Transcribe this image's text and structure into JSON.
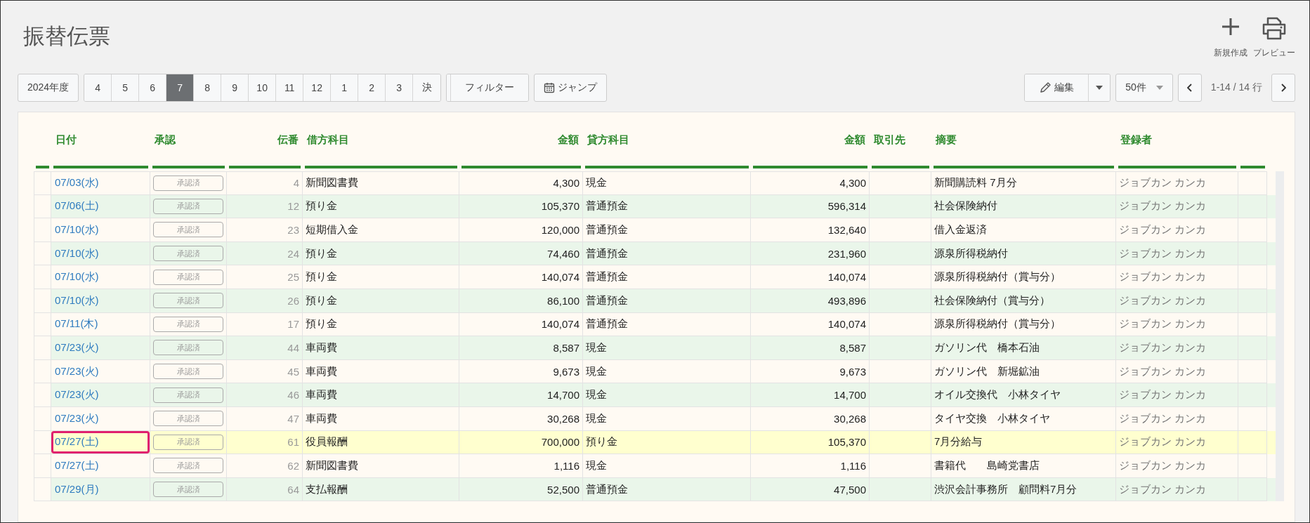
{
  "page": {
    "title": "振替伝票"
  },
  "actions": [
    {
      "kind": "new",
      "label": "新規作成"
    },
    {
      "kind": "preview",
      "label": "プレビュー"
    }
  ],
  "toolbar": {
    "fiscal_year": "2024年度",
    "months": [
      {
        "label": "4",
        "selected": false
      },
      {
        "label": "5",
        "selected": false
      },
      {
        "label": "6",
        "selected": false
      },
      {
        "label": "7",
        "selected": true
      },
      {
        "label": "8",
        "selected": false
      },
      {
        "label": "9",
        "selected": false
      },
      {
        "label": "10",
        "selected": false
      },
      {
        "label": "11",
        "selected": false
      },
      {
        "label": "12",
        "selected": false
      },
      {
        "label": "1",
        "selected": false
      },
      {
        "label": "2",
        "selected": false
      },
      {
        "label": "3",
        "selected": false
      },
      {
        "label": "決",
        "selected": false
      }
    ],
    "filter": "フィルター",
    "jump": "ジャンプ",
    "edit": "編集",
    "page_size": "50件",
    "range": "1-14 / 14 行"
  },
  "table": {
    "columns": [
      "日付",
      "承認",
      "伝番",
      "借方科目",
      "金額",
      "貸方科目",
      "金額",
      "取引先",
      "摘要",
      "登録者"
    ],
    "rows": [
      {
        "date": "07/03(水)",
        "approval": "承認済",
        "number": "4",
        "debit_account": "新聞図書費",
        "debit_amount": "4,300",
        "credit_account": "現金",
        "credit_amount": "4,300",
        "description": "新聞購読料 7月分",
        "registrant": "ジョブカン カンカ",
        "selected": false,
        "highlighted": false
      },
      {
        "date": "07/06(土)",
        "approval": "承認済",
        "number": "12",
        "debit_account": "預り金",
        "debit_amount": "105,370",
        "credit_account": "普通預金",
        "credit_amount": "596,314",
        "description": "社会保険納付",
        "registrant": "ジョブカン カンカ",
        "selected": false,
        "highlighted": false
      },
      {
        "date": "07/10(水)",
        "approval": "承認済",
        "number": "23",
        "debit_account": "短期借入金",
        "debit_amount": "120,000",
        "credit_account": "普通預金",
        "credit_amount": "132,640",
        "description": "借入金返済",
        "registrant": "ジョブカン カンカ",
        "selected": false,
        "highlighted": false
      },
      {
        "date": "07/10(水)",
        "approval": "承認済",
        "number": "24",
        "debit_account": "預り金",
        "debit_amount": "74,460",
        "credit_account": "普通預金",
        "credit_amount": "231,960",
        "description": "源泉所得税納付",
        "registrant": "ジョブカン カンカ",
        "selected": false,
        "highlighted": false
      },
      {
        "date": "07/10(水)",
        "approval": "承認済",
        "number": "25",
        "debit_account": "預り金",
        "debit_amount": "140,074",
        "credit_account": "普通預金",
        "credit_amount": "140,074",
        "description": "源泉所得税納付（賞与分）",
        "registrant": "ジョブカン カンカ",
        "selected": false,
        "highlighted": false
      },
      {
        "date": "07/10(水)",
        "approval": "承認済",
        "number": "26",
        "debit_account": "預り金",
        "debit_amount": "86,100",
        "credit_account": "普通預金",
        "credit_amount": "493,896",
        "description": "社会保険納付（賞与分）",
        "registrant": "ジョブカン カンカ",
        "selected": false,
        "highlighted": false
      },
      {
        "date": "07/11(木)",
        "approval": "承認済",
        "number": "17",
        "debit_account": "預り金",
        "debit_amount": "140,074",
        "credit_account": "普通預金",
        "credit_amount": "140,074",
        "description": "源泉所得税納付（賞与分）",
        "registrant": "ジョブカン カンカ",
        "selected": false,
        "highlighted": false
      },
      {
        "date": "07/23(火)",
        "approval": "承認済",
        "number": "44",
        "debit_account": "車両費",
        "debit_amount": "8,587",
        "credit_account": "現金",
        "credit_amount": "8,587",
        "description": "ガソリン代　橋本石油",
        "registrant": "ジョブカン カンカ",
        "selected": false,
        "highlighted": false
      },
      {
        "date": "07/23(火)",
        "approval": "承認済",
        "number": "45",
        "debit_account": "車両費",
        "debit_amount": "9,673",
        "credit_account": "現金",
        "credit_amount": "9,673",
        "description": "ガソリン代　新堀鉱油",
        "registrant": "ジョブカン カンカ",
        "selected": false,
        "highlighted": false
      },
      {
        "date": "07/23(火)",
        "approval": "承認済",
        "number": "46",
        "debit_account": "車両費",
        "debit_amount": "14,700",
        "credit_account": "現金",
        "credit_amount": "14,700",
        "description": "オイル交換代　小林タイヤ",
        "registrant": "ジョブカン カンカ",
        "selected": false,
        "highlighted": false
      },
      {
        "date": "07/23(火)",
        "approval": "承認済",
        "number": "47",
        "debit_account": "車両費",
        "debit_amount": "30,268",
        "credit_account": "現金",
        "credit_amount": "30,268",
        "description": "タイヤ交換　小林タイヤ",
        "registrant": "ジョブカン カンカ",
        "selected": false,
        "highlighted": false
      },
      {
        "date": "07/27(土)",
        "approval": "承認済",
        "number": "61",
        "debit_account": "役員報酬",
        "debit_amount": "700,000",
        "credit_account": "預り金",
        "credit_amount": "105,370",
        "description": "7月分給与",
        "registrant": "ジョブカン カンカ",
        "selected": true,
        "highlighted": true
      },
      {
        "date": "07/27(土)",
        "approval": "承認済",
        "number": "62",
        "debit_account": "新聞図書費",
        "debit_amount": "1,116",
        "credit_account": "現金",
        "credit_amount": "1,116",
        "description": "書籍代　　島崎党書店",
        "registrant": "ジョブカン カンカ",
        "selected": false,
        "highlighted": false
      },
      {
        "date": "07/29(月)",
        "approval": "承認済",
        "number": "64",
        "debit_account": "支払報酬",
        "debit_amount": "52,500",
        "credit_account": "普通預金",
        "credit_amount": "47,500",
        "description": "渋沢会計事務所　顧問料7月分",
        "registrant": "ジョブカン カンカ",
        "selected": false,
        "highlighted": false
      }
    ]
  }
}
